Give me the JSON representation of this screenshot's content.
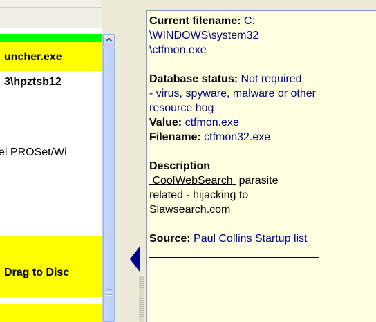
{
  "list": {
    "rows": [
      {
        "text": "uncher.exe",
        "bold": true,
        "highlight": "#ffff00"
      },
      {
        "text": "3\\hpztsb12",
        "bold": true,
        "highlight": ""
      },
      {
        "text": "el PROSet/Wi",
        "bold": false,
        "highlight": ""
      },
      {
        "text": "Drag to Disc",
        "bold": true,
        "highlight": "#ffff00"
      }
    ]
  },
  "scrollbar": {
    "up_arrow_icon": "scroll-up-arrow-icon"
  },
  "splitter": {
    "collapse_icon": "collapse-left-arrow-icon"
  },
  "info": {
    "current_filename_label": "Current filename:",
    "current_filename_value_1": "C:",
    "current_filename_value_2": "\\WINDOWS\\system32",
    "current_filename_value_3": "\\ctfmon.exe",
    "database_status_label": "Database status:",
    "database_status_value_1": "Not required",
    "database_status_value_2": "- virus, spyware, malware or other",
    "database_status_value_3": "resource hog",
    "value_label": "Value:",
    "value_value": "ctfmon.exe",
    "filename_label": "Filename:",
    "filename_value": "ctfmon32.exe",
    "description_label": "Description",
    "description_link": "CoolWebSearch",
    "description_text_1": "parasite",
    "description_text_2": "related - hijacking to",
    "description_text_3": "Slawsearch.com",
    "source_label": "Source:",
    "source_value": "Paul Collins Startup list"
  },
  "colors": {
    "highlight_green": "#00ff00",
    "highlight_yellow": "#ffff00",
    "info_background": "#ffffe1",
    "value_text": "#00008b"
  }
}
